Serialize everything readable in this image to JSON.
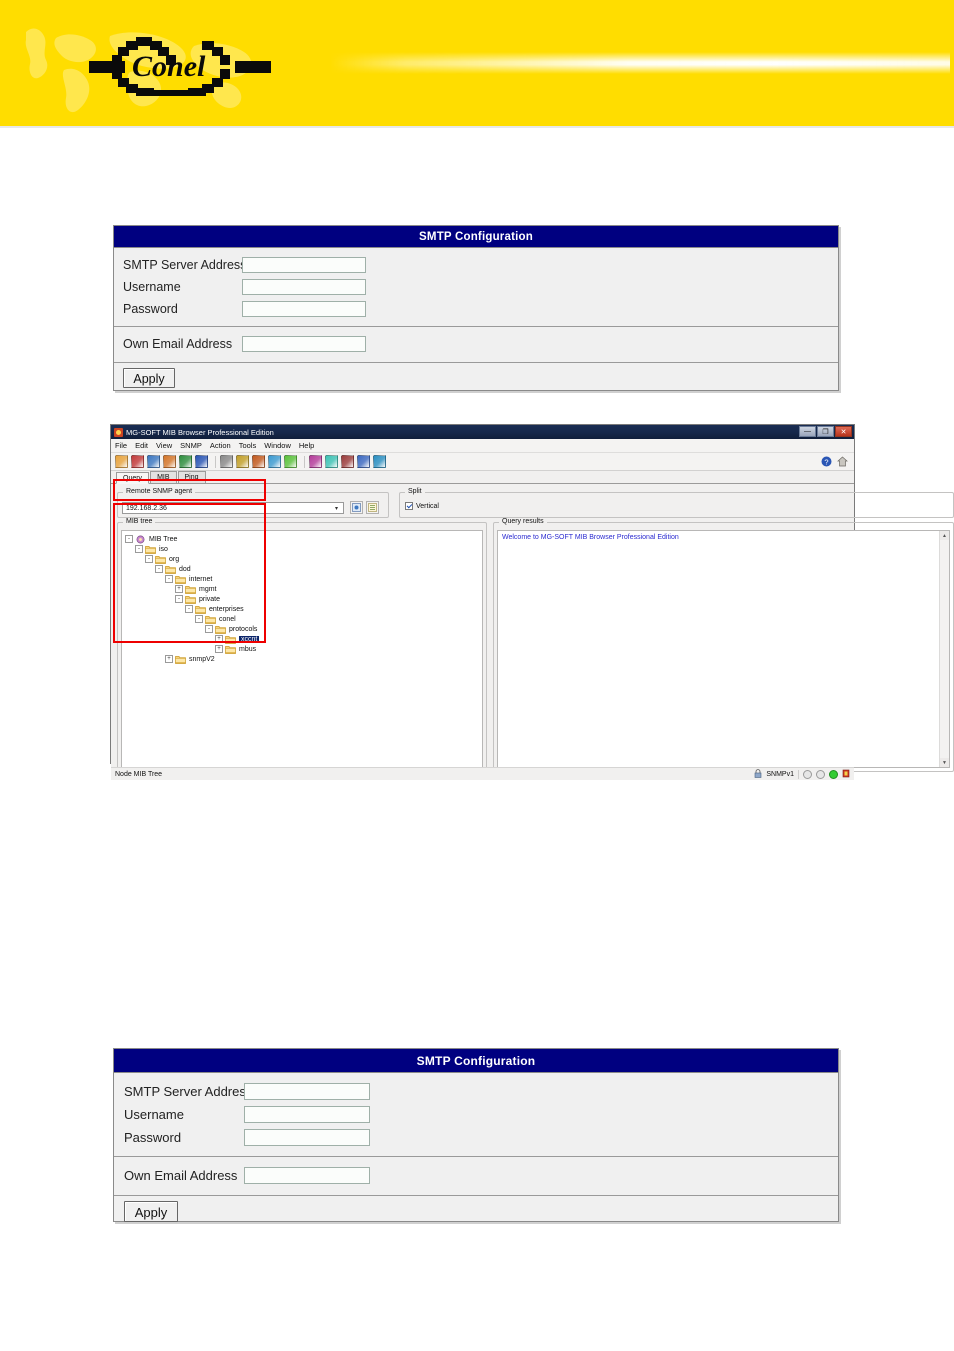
{
  "banner": {
    "logo_text": "Conel",
    "logo_alt": "conel-logo"
  },
  "smtp_form": {
    "title": "SMTP Configuration",
    "fields": [
      {
        "label": "SMTP Server Address",
        "value": "",
        "placeholder": ""
      },
      {
        "label": "Username",
        "value": "",
        "placeholder": ""
      },
      {
        "label": "Password",
        "value": "",
        "placeholder": ""
      }
    ],
    "email_field": {
      "label": "Own Email Address",
      "value": "",
      "placeholder": ""
    },
    "apply_label": "Apply"
  },
  "mib_browser": {
    "window_title": "MG-SOFT MIB Browser Professional Edition",
    "window_buttons": {
      "minimize": "—",
      "restore": "❐",
      "close": "✕"
    },
    "menus": [
      "File",
      "Edit",
      "View",
      "SNMP",
      "Action",
      "Tools",
      "Window",
      "Help"
    ],
    "toolbar_icons": [
      "open-mib-icon",
      "query-icon",
      "globe-clock-icon",
      "tools-icon",
      "globe-icon",
      "info-icon",
      "table-icon",
      "chart-icon",
      "compile-mib-icon",
      "trap-icon",
      "multi-color-icon",
      "settings-gear-icon",
      "refresh-icon",
      "monitor-icon",
      "export-icon",
      "import-icon"
    ],
    "toolbar_icon_colors": [
      "#e8a33d",
      "#c23b3b",
      "#3d78c2",
      "#d4762a",
      "#2f8f3f",
      "#2a56b5",
      "#8a8a8a",
      "#c2a02a",
      "#c25a1f",
      "#3d9bd1",
      "#5ac23b",
      "#b53d9b",
      "#3dc2b5",
      "#9b3d3d",
      "#3d6ac2",
      "#2a8fc2"
    ],
    "toolbar_right_icons": [
      "help-globe-icon",
      "home-icon"
    ],
    "tabs": [
      {
        "label": "Query",
        "active": true
      },
      {
        "label": "MIB",
        "active": false
      },
      {
        "label": "Ping",
        "active": false
      }
    ],
    "agent_group": {
      "legend": "Remote SNMP agent",
      "address": "192.168.2.36",
      "dropdown_arrow": "▾",
      "button_1": "ping-agent-button",
      "button_2": "agent-properties-button"
    },
    "split_group": {
      "legend": "Split",
      "checkbox_label": "Vertical",
      "checked": true
    },
    "mib_tree": {
      "legend": "MIB tree",
      "nodes": [
        {
          "label": "MIB Tree",
          "depth": 0,
          "expander": "-",
          "root": true,
          "selected": false
        },
        {
          "label": "iso",
          "depth": 1,
          "expander": "-",
          "root": false,
          "selected": false
        },
        {
          "label": "org",
          "depth": 2,
          "expander": "-",
          "root": false,
          "selected": false
        },
        {
          "label": "dod",
          "depth": 3,
          "expander": "-",
          "root": false,
          "selected": false
        },
        {
          "label": "internet",
          "depth": 4,
          "expander": "-",
          "root": false,
          "selected": false
        },
        {
          "label": "mgmt",
          "depth": 5,
          "expander": "+",
          "root": false,
          "selected": false
        },
        {
          "label": "private",
          "depth": 5,
          "expander": "-",
          "root": false,
          "selected": false
        },
        {
          "label": "enterprises",
          "depth": 6,
          "expander": "-",
          "root": false,
          "selected": false
        },
        {
          "label": "conel",
          "depth": 7,
          "expander": "-",
          "root": false,
          "selected": false
        },
        {
          "label": "protocols",
          "depth": 8,
          "expander": "-",
          "root": false,
          "selected": false
        },
        {
          "label": "xccnt",
          "depth": 9,
          "expander": "+",
          "root": false,
          "selected": true
        },
        {
          "label": "mbus",
          "depth": 9,
          "expander": "+",
          "root": false,
          "selected": false
        },
        {
          "label": "snmpV2",
          "depth": 4,
          "expander": "+",
          "root": false,
          "selected": false
        }
      ]
    },
    "query_results": {
      "legend": "Query results",
      "text": "Welcome to MG-SOFT MIB Browser Professional Edition",
      "text_color": "#2b2bd0"
    },
    "statusbar": {
      "left_text": "Node MIB Tree",
      "lock_icon": "lock-icon",
      "version": "SNMPv1",
      "leds": [
        "off",
        "off",
        "green"
      ],
      "trailing_icon": "trap-receiver-icon"
    }
  },
  "colors": {
    "banner": "#ffdd00",
    "title_bar": "#000080",
    "annotation": "#ee0000",
    "form_bg": "#f0f0f0",
    "selection": "#0a246a"
  }
}
